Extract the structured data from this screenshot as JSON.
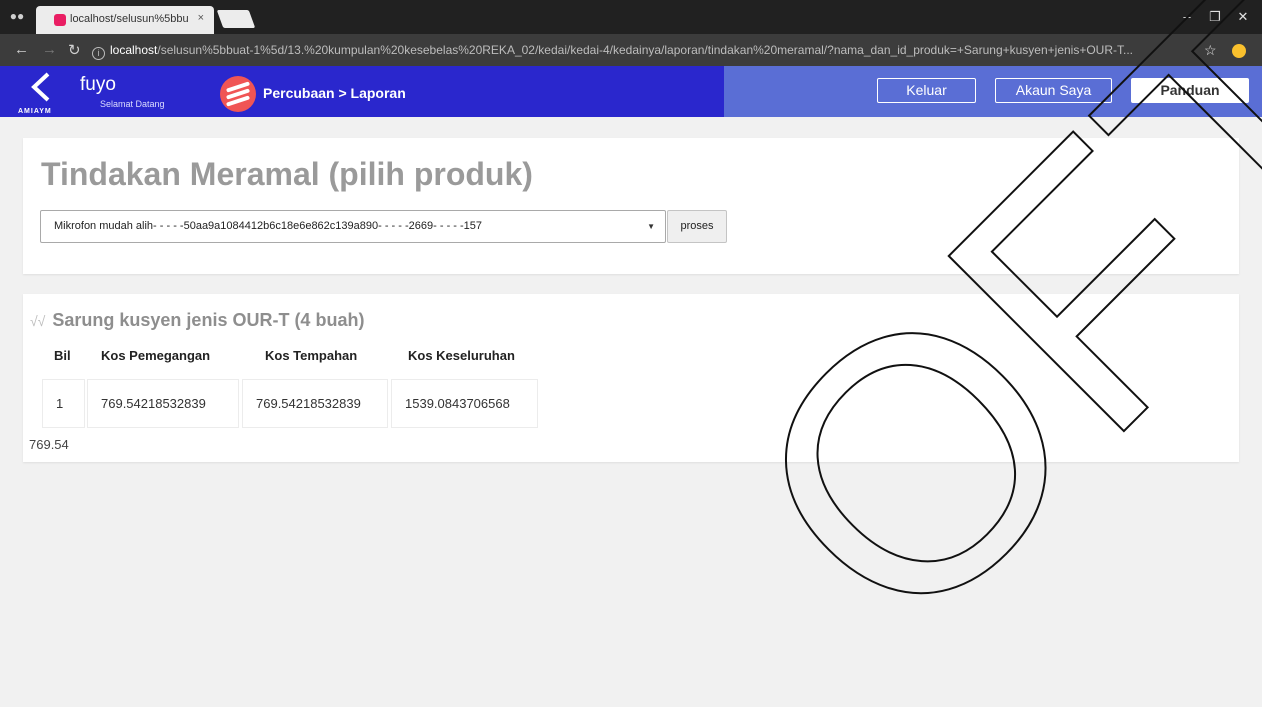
{
  "browser": {
    "tab_title": "localhost/selusun%5bbu",
    "tab_close": "×",
    "url_host": "localhost",
    "url_rest": "/selusun%5bbuat-1%5d/13.%20kumpulan%20kesebelas%20REKA_02/kedai/kedai-4/kedainya/laporan/tindakan%20meramal/?nama_dan_id_produk=+Sarung+kusyen+jenis+OUR-T...",
    "icons": {
      "incognito": "incognito-icon",
      "back": "back-arrow-icon",
      "forward": "forward-arrow-icon",
      "reload": "reload-icon",
      "info": "info-icon",
      "star": "star-icon",
      "minimize": "minimize-icon",
      "restore": "restore-icon",
      "close": "close-icon"
    }
  },
  "header": {
    "brand_name": "fuyo",
    "brand_sub": "Selamat Datang",
    "brand_strip": "AMIAYM",
    "breadcrumb": "Percubaan > Laporan",
    "buttons": {
      "keluar": "Keluar",
      "akaun": "Akaun Saya",
      "panduan": "Panduan"
    },
    "colors": {
      "primary": "#2a27cd",
      "secondary": "#5a6ed5",
      "logo": "#f05555"
    }
  },
  "main": {
    "title": "Tindakan Meramal (pilih produk)",
    "select_value": "Mikrofon mudah alih- - - - -50aa9a1084412b6c18e6e862c139a890- - - - -2669- - - - -157",
    "proses_label": "proses",
    "result": {
      "checkmarks": "√√",
      "title": "Sarung kusyen jenis OUR-T (4 buah)",
      "columns": [
        "Bil",
        "Kos Pemegangan",
        "Kos Tempahan",
        "Kos Keseluruhan"
      ],
      "rows": [
        [
          "1",
          "769.54218532839",
          "769.54218532839",
          "1539.0843706568"
        ]
      ],
      "footnote": "769.54"
    }
  },
  "watermark_text": "OFTSM"
}
